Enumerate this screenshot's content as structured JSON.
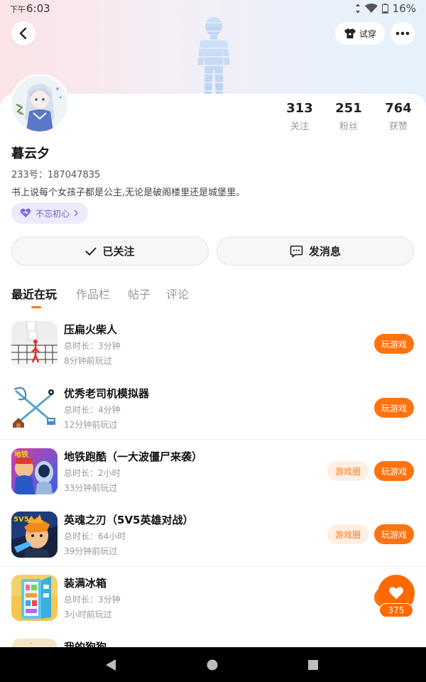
{
  "status": {
    "time_prefix": "下午",
    "time": "6:03",
    "battery": "16%"
  },
  "header": {
    "tryon_label": "试穿"
  },
  "profile": {
    "name": "暮云夕",
    "id_line": "233号：187047835",
    "bio": "书上说每个女孩子都是公主,无论是破阁楼里还是城堡里。",
    "badge": "不忘初心"
  },
  "stats": [
    {
      "value": "313",
      "label": "关注"
    },
    {
      "value": "251",
      "label": "粉丝"
    },
    {
      "value": "764",
      "label": "获赞"
    }
  ],
  "actions": {
    "followed": "已关注",
    "message": "发消息"
  },
  "tabs": [
    "最近在玩",
    "作品栏",
    "帖子",
    "评论"
  ],
  "games": [
    {
      "name": "压扁火柴人",
      "duration": "总时长：3分钟",
      "ago": "8分钟前玩过",
      "play": "玩游戏"
    },
    {
      "name": "优秀老司机模拟器",
      "duration": "总时长：4分钟",
      "ago": "12分钟前玩过",
      "play": "玩游戏"
    },
    {
      "name": "地铁跑酷（一大波僵尸来袭）",
      "duration": "总时长：2小时",
      "ago": "33分钟前玩过",
      "play": "玩游戏",
      "circle": "游戏圈"
    },
    {
      "name": "英魂之刃（5V5英雄对战）",
      "duration": "总时长：64小时",
      "ago": "39分钟前玩过",
      "play": "玩游戏",
      "circle": "游戏圈"
    },
    {
      "name": "装满冰箱",
      "duration": "总时长：3分钟",
      "ago": "3小时前玩过",
      "play": "玩游戏"
    },
    {
      "name": "我的狗狗"
    }
  ],
  "float": {
    "count": "375"
  },
  "colors": {
    "accent": "#ff7210",
    "badge_text": "#6b5fd0"
  }
}
